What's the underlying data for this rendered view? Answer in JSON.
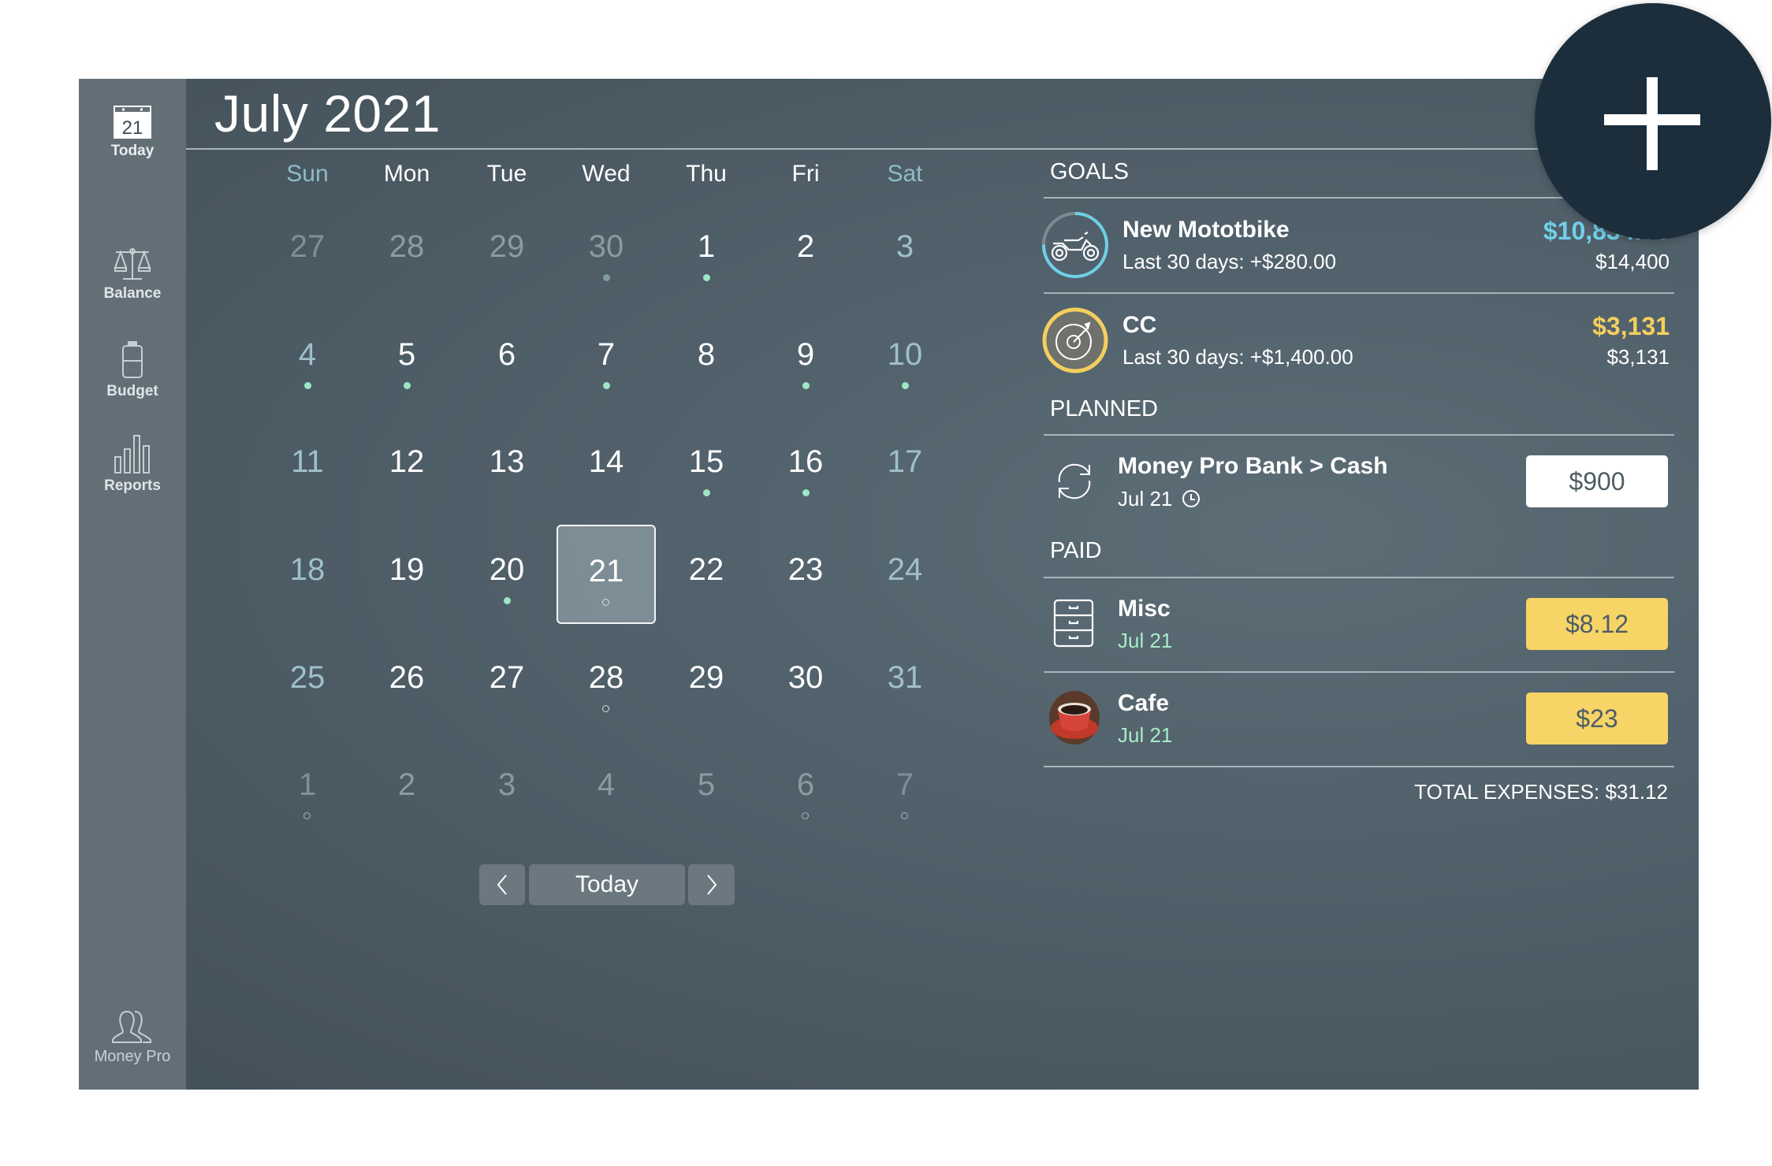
{
  "sidebar": {
    "items": [
      {
        "label": "Today",
        "icon": "calendar-icon",
        "icon_text": "21"
      },
      {
        "label": "Balance",
        "icon": "scales-icon"
      },
      {
        "label": "Budget",
        "icon": "battery-icon"
      },
      {
        "label": "Reports",
        "icon": "bar-chart-icon"
      }
    ],
    "bottom": {
      "label": "Money Pro",
      "icon": "users-icon"
    }
  },
  "calendar": {
    "title": "July 2021",
    "weekdays": [
      "Sun",
      "Mon",
      "Tue",
      "Wed",
      "Thu",
      "Fri",
      "Sat"
    ],
    "weeks": [
      [
        {
          "d": "27",
          "other": true
        },
        {
          "d": "28",
          "other": true
        },
        {
          "d": "29",
          "other": true
        },
        {
          "d": "30",
          "other": true,
          "dot": "filled"
        },
        {
          "d": "1",
          "dot": "filled"
        },
        {
          "d": "2"
        },
        {
          "d": "3"
        }
      ],
      [
        {
          "d": "4",
          "dot": "filled"
        },
        {
          "d": "5",
          "dot": "filled"
        },
        {
          "d": "6"
        },
        {
          "d": "7",
          "dot": "filled"
        },
        {
          "d": "8"
        },
        {
          "d": "9",
          "dot": "filled"
        },
        {
          "d": "10",
          "dot": "filled"
        }
      ],
      [
        {
          "d": "11"
        },
        {
          "d": "12"
        },
        {
          "d": "13"
        },
        {
          "d": "14"
        },
        {
          "d": "15",
          "dot": "filled"
        },
        {
          "d": "16",
          "dot": "filled"
        },
        {
          "d": "17"
        }
      ],
      [
        {
          "d": "18"
        },
        {
          "d": "19"
        },
        {
          "d": "20",
          "dot": "filled"
        },
        {
          "d": "21",
          "dot": "hollow",
          "selected": true
        },
        {
          "d": "22"
        },
        {
          "d": "23"
        },
        {
          "d": "24"
        }
      ],
      [
        {
          "d": "25"
        },
        {
          "d": "26"
        },
        {
          "d": "27"
        },
        {
          "d": "28",
          "dot": "hollow"
        },
        {
          "d": "29"
        },
        {
          "d": "30"
        },
        {
          "d": "31"
        }
      ],
      [
        {
          "d": "1",
          "other": true,
          "dot": "hollow"
        },
        {
          "d": "2",
          "other": true
        },
        {
          "d": "3",
          "other": true
        },
        {
          "d": "4",
          "other": true
        },
        {
          "d": "5",
          "other": true
        },
        {
          "d": "6",
          "other": true,
          "dot": "hollow"
        },
        {
          "d": "7",
          "other": true,
          "dot": "hollow"
        }
      ]
    ],
    "nav": {
      "prev": "‹",
      "today": "Today",
      "next": "›"
    }
  },
  "goals": {
    "title": "GOALS",
    "items": [
      {
        "name": "New Mototbike",
        "sub": "Last 30 days: +$280.00",
        "saved": "$10,834.00",
        "target": "$14,400",
        "progress": 0.75,
        "color": "#6fd0e8",
        "icon": "motorbike-icon"
      },
      {
        "name": "CC",
        "sub": "Last 30 days: +$1,400.00",
        "saved": "$3,131",
        "target": "$3,131",
        "progress": 1.0,
        "color": "#f4cf5e",
        "icon": "target-icon"
      }
    ]
  },
  "planned": {
    "title": "PLANNED",
    "items": [
      {
        "name": "Money Pro Bank > Cash",
        "date": "Jul 21",
        "amount": "$900",
        "icon": "transfer-icon"
      }
    ]
  },
  "paid": {
    "title": "PAID",
    "items": [
      {
        "name": "Misc",
        "date": "Jul 21",
        "amount": "$8.12",
        "icon": "cabinet-icon"
      },
      {
        "name": "Cafe",
        "date": "Jul 21",
        "amount": "$23",
        "icon": "coffee-cup-icon"
      }
    ],
    "total": "TOTAL EXPENSES: $31.12"
  },
  "fab": {
    "icon": "plus-icon"
  }
}
